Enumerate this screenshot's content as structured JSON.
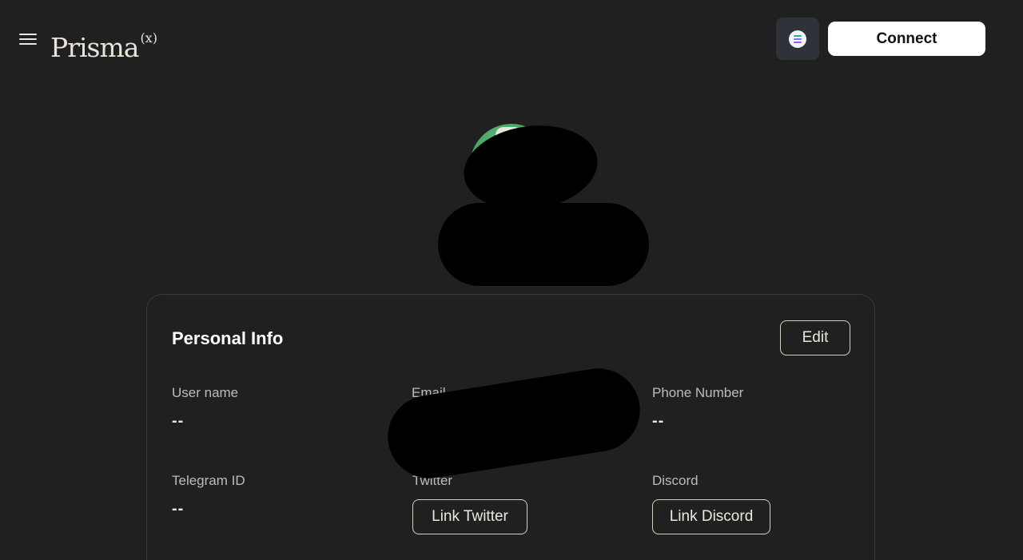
{
  "header": {
    "logo_text": "Prisma",
    "logo_superscript": "(x)",
    "connect_label": "Connect",
    "chain_icon": "solana-icon",
    "chain_icon_colors": [
      "#9945ff",
      "#5b8df0",
      "#14f195"
    ]
  },
  "card": {
    "title": "Personal Info",
    "edit_label": "Edit",
    "fields": {
      "username": {
        "label": "User name",
        "value": "--"
      },
      "email": {
        "label": "Email"
      },
      "phone": {
        "label": "Phone Number",
        "value": "--"
      },
      "telegram": {
        "label": "Telegram ID",
        "value": "--"
      },
      "twitter": {
        "label": "Twitter",
        "button": "Link Twitter"
      },
      "discord": {
        "label": "Discord",
        "button": "Link Discord"
      }
    }
  }
}
